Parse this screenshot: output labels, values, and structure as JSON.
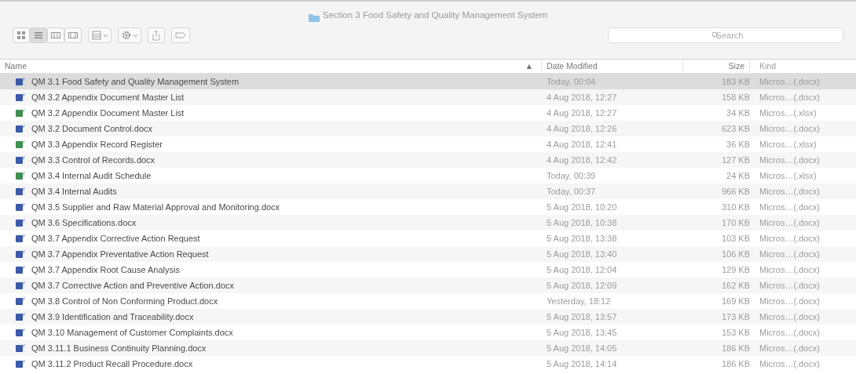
{
  "window": {
    "title": "Section 3 Food Safety and Quality Management System"
  },
  "toolbar": {
    "views": [
      {
        "kind": "icons",
        "selected": false
      },
      {
        "kind": "list",
        "selected": true
      },
      {
        "kind": "columns",
        "selected": false
      },
      {
        "kind": "gallery",
        "selected": false
      }
    ]
  },
  "search": {
    "placeholder": "Search"
  },
  "table": {
    "columns": [
      {
        "label": "Name",
        "sort": "▲"
      },
      {
        "label": "Date Modified"
      },
      {
        "label": "Size"
      },
      {
        "label": "Kind"
      }
    ],
    "rows": [
      {
        "kind": "doc",
        "name": "QM 3.1 Food Safety and Quality Management System",
        "date": "Today, 00:04",
        "size": "183 KB",
        "type": "Micros…(.docx)",
        "selected": true
      },
      {
        "kind": "doc",
        "name": "QM 3.2 Appendix Document Master List",
        "date": "4 Aug 2018, 12:27",
        "size": "158 KB",
        "type": "Micros…(.docx)",
        "selected": false
      },
      {
        "kind": "xls",
        "name": "QM 3.2 Appendix Document Master List",
        "date": "4 Aug 2018, 12:27",
        "size": "34 KB",
        "type": "Micros…(.xlsx)",
        "selected": false
      },
      {
        "kind": "doc",
        "name": "QM 3.2 Document Control.docx",
        "date": "4 Aug 2018, 12:26",
        "size": "623 KB",
        "type": "Micros…(.docx)",
        "selected": false
      },
      {
        "kind": "xls",
        "name": "QM 3.3 Appendix Record Register",
        "date": "4 Aug 2018, 12:41",
        "size": "36 KB",
        "type": "Micros…(.xlsx)",
        "selected": false
      },
      {
        "kind": "doc",
        "name": "QM 3.3 Control of Records.docx",
        "date": "4 Aug 2018, 12:42",
        "size": "127 KB",
        "type": "Micros…(.docx)",
        "selected": false
      },
      {
        "kind": "xls",
        "name": "QM 3.4 Internal Audit Schedule",
        "date": "Today, 00:39",
        "size": "24 KB",
        "type": "Micros…(.xlsx)",
        "selected": false
      },
      {
        "kind": "doc",
        "name": "QM 3.4 Internal Audits",
        "date": "Today, 00:37",
        "size": "966 KB",
        "type": "Micros…(.docx)",
        "selected": false
      },
      {
        "kind": "doc",
        "name": "QM 3.5 Supplier and Raw Material Approval and Monitoring.docx",
        "date": "5 Aug 2018, 10:20",
        "size": "310 KB",
        "type": "Micros…(.docx)",
        "selected": false
      },
      {
        "kind": "doc",
        "name": "QM 3.6 Specifications.docx",
        "date": "5 Aug 2018, 10:38",
        "size": "170 KB",
        "type": "Micros…(.docx)",
        "selected": false
      },
      {
        "kind": "doc",
        "name": "QM 3.7 Appendix Corrective Action Request",
        "date": "5 Aug 2018, 13:38",
        "size": "103 KB",
        "type": "Micros…(.docx)",
        "selected": false
      },
      {
        "kind": "doc",
        "name": "QM 3.7 Appendix Preventative Action Request",
        "date": "5 Aug 2018, 13:40",
        "size": "106 KB",
        "type": "Micros…(.docx)",
        "selected": false
      },
      {
        "kind": "doc",
        "name": "QM 3.7 Appendix Root Cause Analysis",
        "date": "5 Aug 2018, 12:04",
        "size": "129 KB",
        "type": "Micros…(.docx)",
        "selected": false
      },
      {
        "kind": "doc",
        "name": "QM 3.7 Corrective Action and Preventive Action.docx",
        "date": "5 Aug 2018, 12:09",
        "size": "162 KB",
        "type": "Micros…(.docx)",
        "selected": false
      },
      {
        "kind": "doc",
        "name": "QM 3.8 Control of Non Conforming Product.docx",
        "date": "Yesterday, 18:12",
        "size": "169 KB",
        "type": "Micros…(.docx)",
        "selected": false
      },
      {
        "kind": "doc",
        "name": "QM 3.9 Identification and Traceability.docx",
        "date": "5 Aug 2018, 13:57",
        "size": "173 KB",
        "type": "Micros…(.docx)",
        "selected": false
      },
      {
        "kind": "doc",
        "name": "QM 3.10 Management of Customer Complaints.docx",
        "date": "5 Aug 2018, 13:45",
        "size": "153 KB",
        "type": "Micros…(.docx)",
        "selected": false
      },
      {
        "kind": "doc",
        "name": "QM 3.11.1 Business Continuity Planning.docx",
        "date": "5 Aug 2018, 14:05",
        "size": "186 KB",
        "type": "Micros…(.docx)",
        "selected": false
      },
      {
        "kind": "doc",
        "name": "QM 3.11.2 Product Recall Procedure.docx",
        "date": "5 Aug 2018, 14:14",
        "size": "186 KB",
        "type": "Micros…(.docx)",
        "selected": false
      }
    ]
  }
}
